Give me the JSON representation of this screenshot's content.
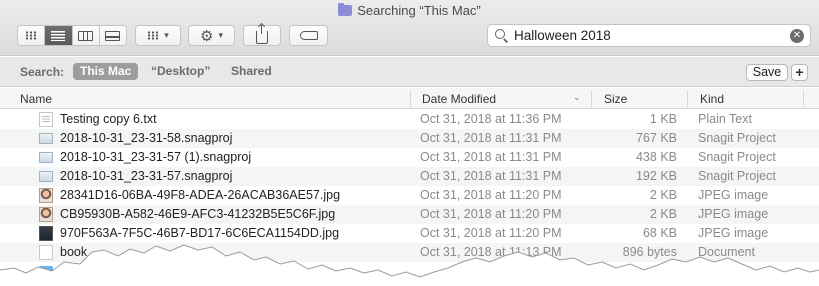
{
  "window": {
    "title": "Searching “This Mac”"
  },
  "toolbar": {
    "view_modes": [
      {
        "name": "icon-view",
        "icon": "grid-icon",
        "selected": false
      },
      {
        "name": "list-view",
        "icon": "list-icon",
        "selected": true
      },
      {
        "name": "column-view",
        "icon": "columns-icon",
        "selected": false
      },
      {
        "name": "gallery-view",
        "icon": "gallery-icon",
        "selected": false
      }
    ],
    "group_icon": "group-grid-icon",
    "action_icon": "gear-icon",
    "share_icon": "share-icon",
    "tags_icon": "tag-icon"
  },
  "search": {
    "value": "Halloween 2018",
    "clear_icon": "clear-icon"
  },
  "scope_bar": {
    "label": "Search:",
    "scopes": [
      {
        "label": "This Mac",
        "selected": true
      },
      {
        "label": "“Desktop”",
        "selected": false
      },
      {
        "label": "Shared",
        "selected": false
      }
    ],
    "save_label": "Save",
    "add_label": "+"
  },
  "columns": {
    "name": "Name",
    "date_modified": "Date Modified",
    "size": "Size",
    "kind": "Kind"
  },
  "files": [
    {
      "name": "Testing copy 6.txt",
      "date": "Oct 31, 2018 at 11:36 PM",
      "size": "1 KB",
      "kind": "Plain Text",
      "icon": "text-file-icon"
    },
    {
      "name": "2018-10-31_23-31-58.snagproj",
      "date": "Oct 31, 2018 at 11:31 PM",
      "size": "767 KB",
      "kind": "Snagit Project",
      "icon": "snagit-file-icon"
    },
    {
      "name": "2018-10-31_23-31-57 (1).snagproj",
      "date": "Oct 31, 2018 at 11:31 PM",
      "size": "438 KB",
      "kind": "Snagit Project",
      "icon": "snagit-file-icon"
    },
    {
      "name": "2018-10-31_23-31-57.snagproj",
      "date": "Oct 31, 2018 at 11:31 PM",
      "size": "192 KB",
      "kind": "Snagit Project",
      "icon": "snagit-file-icon"
    },
    {
      "name": "28341D16-06BA-49F8-ADEA-26ACAB36AE57.jpg",
      "date": "Oct 31, 2018 at 11:20 PM",
      "size": "2 KB",
      "kind": "JPEG image",
      "icon": "jpeg-portrait-icon"
    },
    {
      "name": "CB95930B-A582-46E9-AFC3-41232B5E5C6F.jpg",
      "date": "Oct 31, 2018 at 11:20 PM",
      "size": "2 KB",
      "kind": "JPEG image",
      "icon": "jpeg-portrait-icon"
    },
    {
      "name": "970F563A-7F5C-46B7-BD17-6C6ECA1154DD.jpg",
      "date": "Oct 31, 2018 at 11:20 PM",
      "size": "68 KB",
      "kind": "JPEG image",
      "icon": "jpeg-dark-icon"
    },
    {
      "name": "book",
      "date": "Oct 31, 2018 at 11:13 PM",
      "size": "896 bytes",
      "kind": "Document",
      "icon": "document-icon"
    },
    {
      "name": "",
      "date": "",
      "size": "",
      "kind": "",
      "icon": "folder-icon"
    }
  ],
  "colors": {
    "selected_scope": "#9d9d9d",
    "row_alt": "#f4f5f5",
    "secondary_text": "#8a8a8a"
  }
}
